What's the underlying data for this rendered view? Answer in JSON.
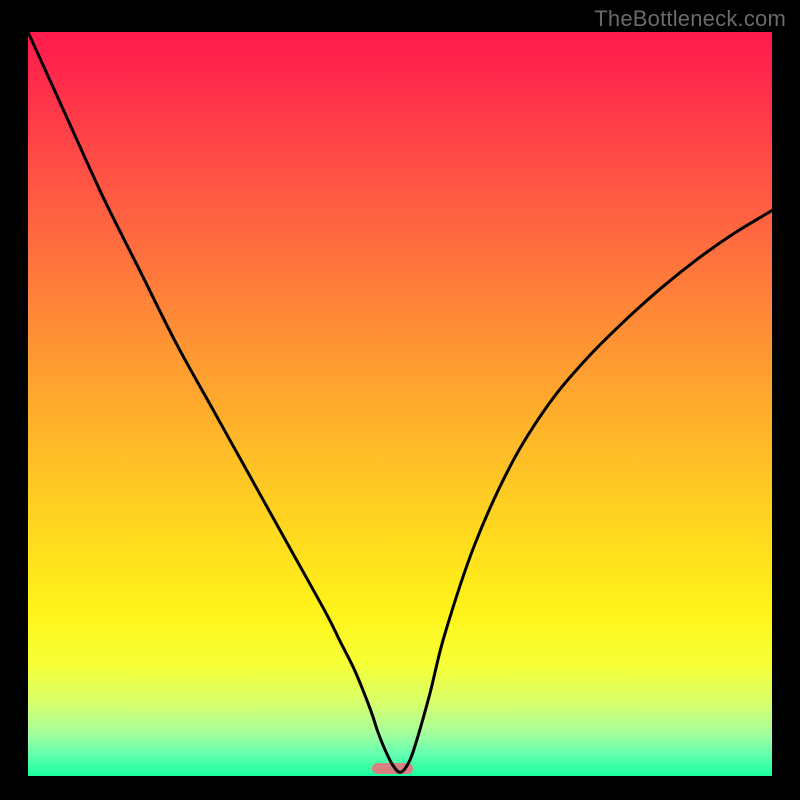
{
  "watermark": "TheBottleneck.com",
  "chart_data": {
    "type": "line",
    "title": "",
    "xlabel": "",
    "ylabel": "",
    "xlim": [
      0,
      100
    ],
    "ylim": [
      0,
      100
    ],
    "series": [
      {
        "name": "curve",
        "x": [
          0,
          5,
          10,
          15,
          20,
          25,
          30,
          35,
          40,
          42,
          44,
          46,
          47,
          48,
          49,
          50,
          51,
          52,
          54,
          56,
          60,
          65,
          70,
          75,
          80,
          85,
          90,
          95,
          100
        ],
        "y": [
          100,
          89,
          78,
          68,
          58,
          49,
          40,
          31,
          22,
          18,
          14,
          9,
          6,
          3.5,
          1.5,
          0.5,
          1.5,
          4,
          11,
          19,
          31,
          42,
          50,
          56,
          61,
          65.5,
          69.5,
          73,
          76
        ]
      }
    ],
    "background_gradient": {
      "top": "#ff1a4c",
      "mid": "#ffdb1e",
      "bottom": "#1aff9e"
    },
    "marker": {
      "x_center_pct": 49,
      "y_pct": 99,
      "width_pct": 5.5,
      "height_pct": 1.6,
      "color": "#d98080"
    }
  }
}
